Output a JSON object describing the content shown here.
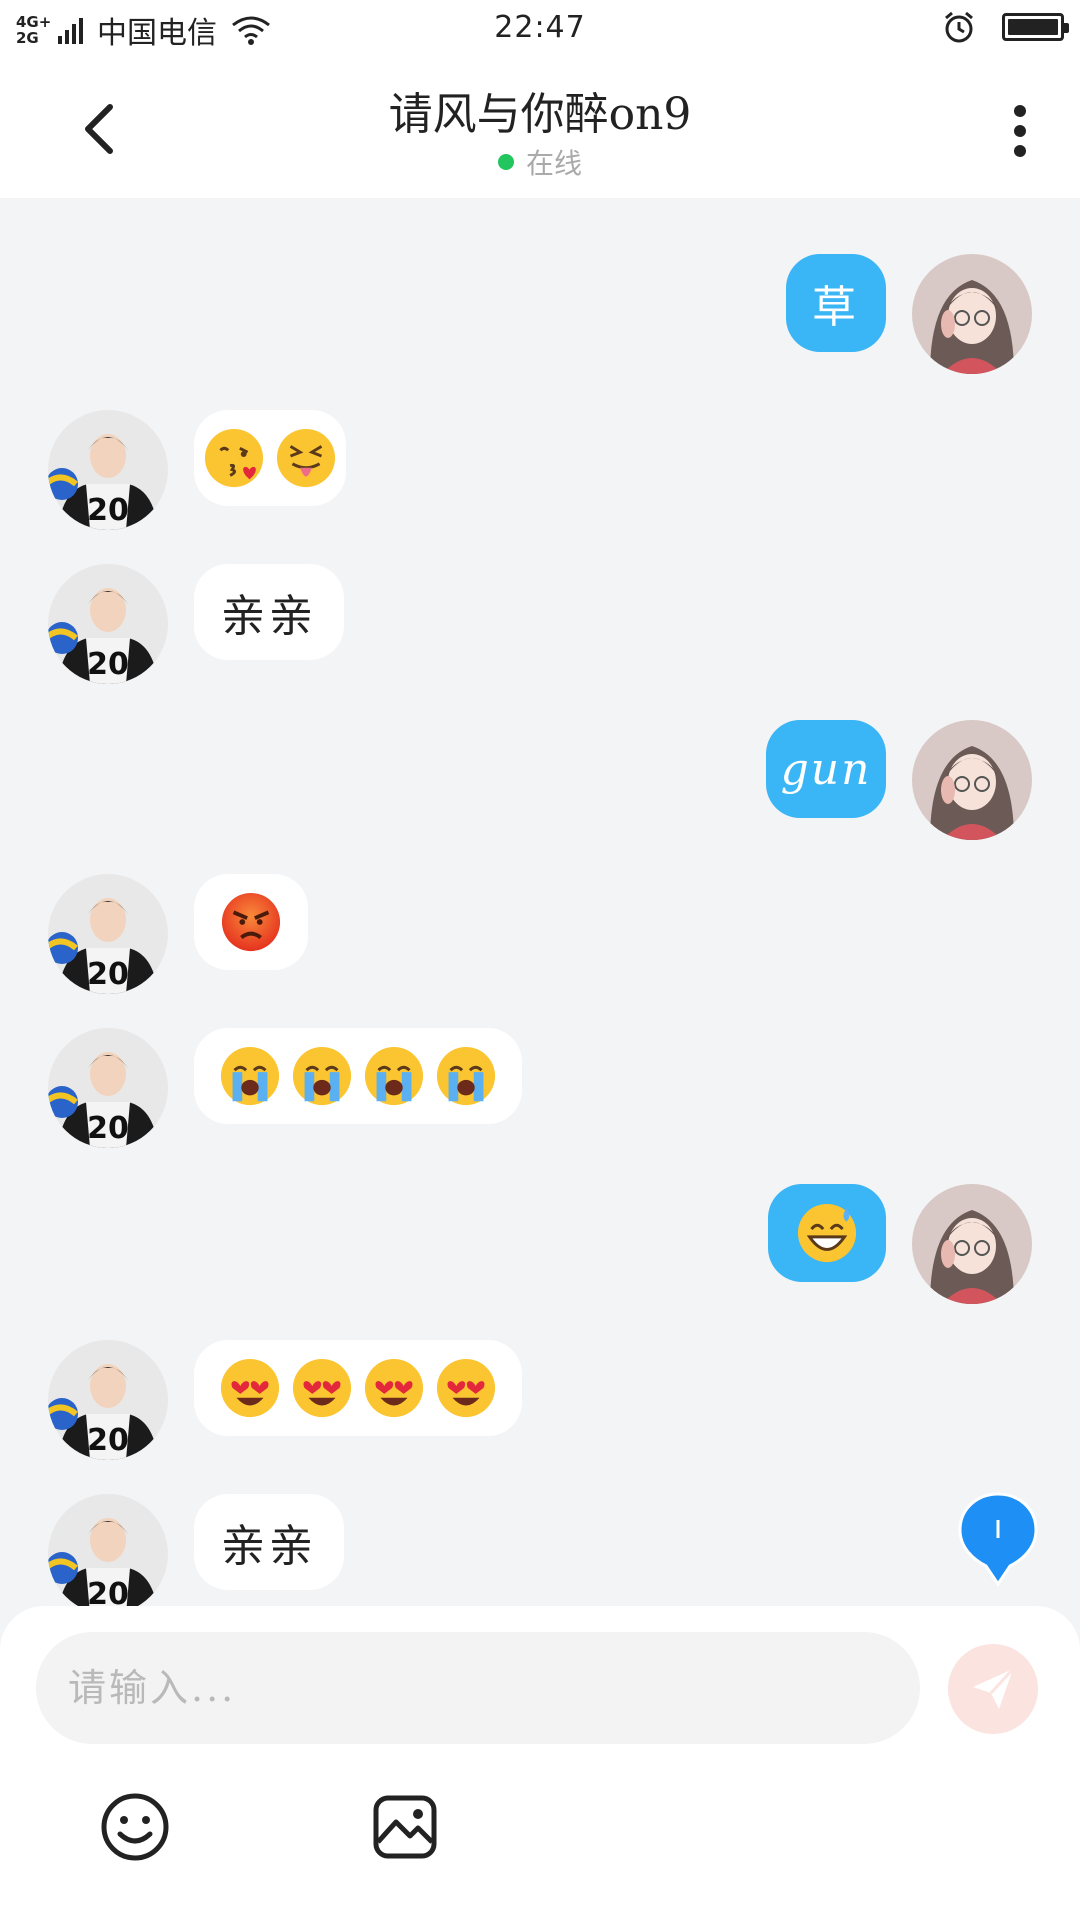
{
  "status_bar": {
    "network": "4G+\n2G",
    "carrier": "中国电信",
    "time": "22:47",
    "battery_level": 1.0
  },
  "header": {
    "title": "请风与你醉on9",
    "status": "在线",
    "back_icon": "chevron-left-icon",
    "more_icon": "more-vertical-icon"
  },
  "messages": [
    {
      "side": "right",
      "type": "text",
      "text": "草"
    },
    {
      "side": "left",
      "type": "emoji",
      "emojis": [
        "kissing-heart",
        "squinting-tongue"
      ]
    },
    {
      "side": "left",
      "type": "text",
      "text": "亲亲"
    },
    {
      "side": "right",
      "type": "text",
      "text": "gun"
    },
    {
      "side": "left",
      "type": "emoji",
      "emojis": [
        "angry"
      ]
    },
    {
      "side": "left",
      "type": "emoji",
      "emojis": [
        "loudly-crying",
        "loudly-crying",
        "loudly-crying",
        "loudly-crying"
      ]
    },
    {
      "side": "right",
      "type": "emoji",
      "emojis": [
        "grinning-sweat"
      ]
    },
    {
      "side": "left",
      "type": "emoji",
      "emojis": [
        "heart-eyes",
        "heart-eyes",
        "heart-eyes",
        "heart-eyes"
      ]
    },
    {
      "side": "left",
      "type": "text",
      "text": "亲亲"
    }
  ],
  "input": {
    "placeholder": "请输入...",
    "value": ""
  },
  "toolbar": {
    "emoji_icon": "smiley-icon",
    "image_icon": "image-icon",
    "send_icon": "paper-plane-icon"
  },
  "colors": {
    "outgoing_bubble": "#3ab5f5",
    "incoming_bubble": "#ffffff",
    "background": "#f3f4f6",
    "online": "#22c55e",
    "float_button": "#1e90f5"
  }
}
